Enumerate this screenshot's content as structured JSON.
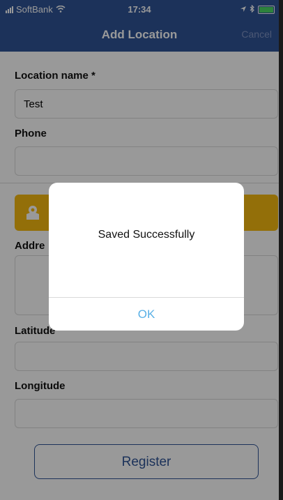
{
  "status": {
    "carrier": "SoftBank",
    "time": "17:34"
  },
  "nav": {
    "title": "Add Location",
    "cancel_label": "Cancel"
  },
  "form": {
    "location_name_label": "Location name *",
    "location_name_value": "Test",
    "phone_label": "Phone",
    "phone_value": "",
    "address_label": "Addre",
    "latitude_label": "Latitude",
    "longitude_label": "Longitude",
    "register_label": "Register"
  },
  "dialog": {
    "message": "Saved Successfully",
    "ok_label": "OK"
  },
  "colors": {
    "header": "#2f5496",
    "map_button": "#f6b90f",
    "ok_text": "#5ab0e6"
  },
  "icons": {
    "map_button": "map-pin-icon"
  }
}
